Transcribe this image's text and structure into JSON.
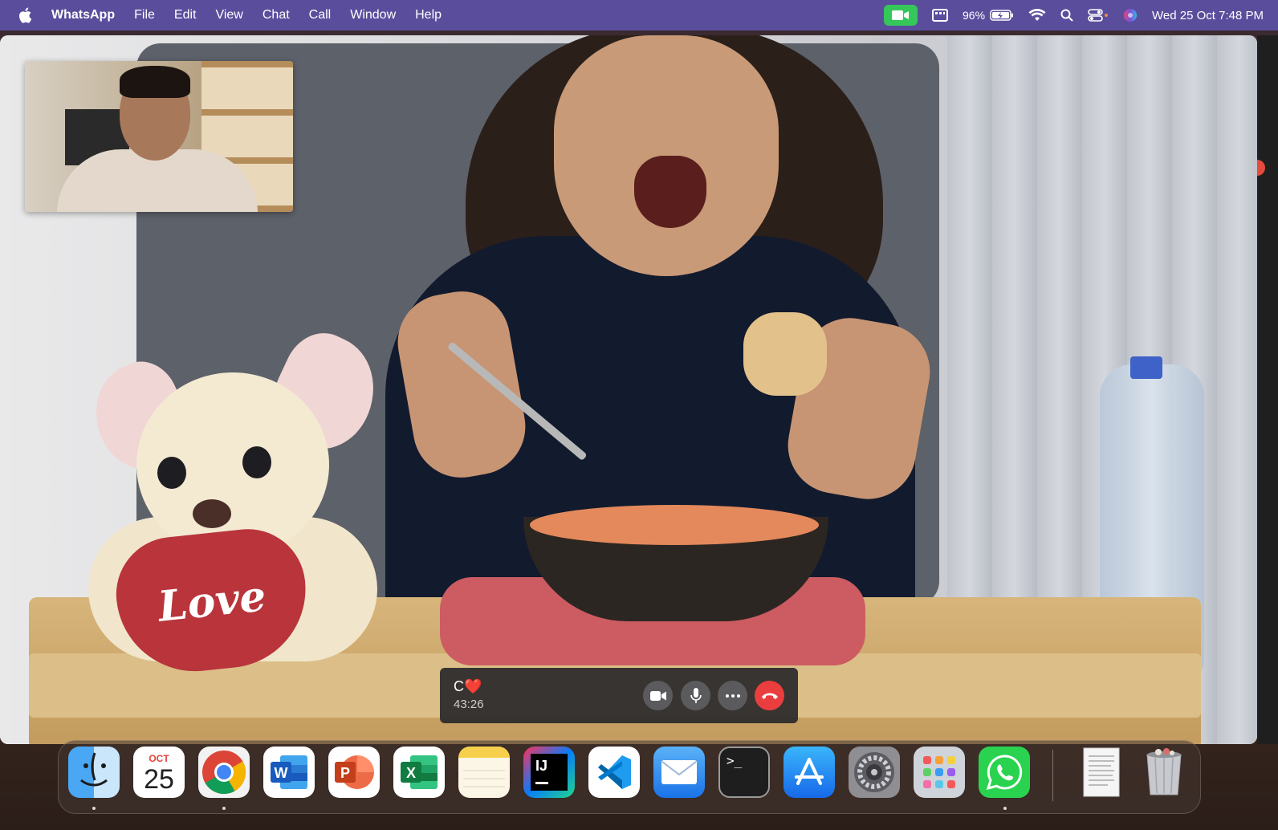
{
  "menubar": {
    "app_name": "WhatsApp",
    "items": [
      "File",
      "Edit",
      "View",
      "Chat",
      "Call",
      "Window",
      "Help"
    ],
    "battery": "96%",
    "clock": "Wed 25 Oct  7:48 PM"
  },
  "call": {
    "caller_name": "C❤️",
    "timer": "43:26",
    "buttons": {
      "video": "camera-icon",
      "mic": "microphone-icon",
      "more": "more-icon",
      "end": "end-call-icon"
    },
    "background_text": "Love"
  },
  "dock": {
    "calendar_month": "OCT",
    "calendar_day": "25",
    "apps": [
      "Finder",
      "Calendar",
      "Google Chrome",
      "Microsoft Word",
      "Microsoft PowerPoint",
      "Microsoft Excel",
      "Notes",
      "IntelliJ IDEA",
      "Visual Studio Code",
      "Mail",
      "Terminal",
      "App Store",
      "System Settings",
      "Launchpad",
      "WhatsApp",
      "Document",
      "Trash"
    ],
    "intellij_label": "IJ",
    "word_label": "W",
    "ppt_label": "P",
    "excel_label": "X",
    "terminal_prompt": ">_"
  },
  "colors": {
    "menubar_bg": "#5a4e9c",
    "facetime_green": "#35c759",
    "end_call_red": "#ea3e3e",
    "whatsapp_green": "#2ad34f"
  }
}
